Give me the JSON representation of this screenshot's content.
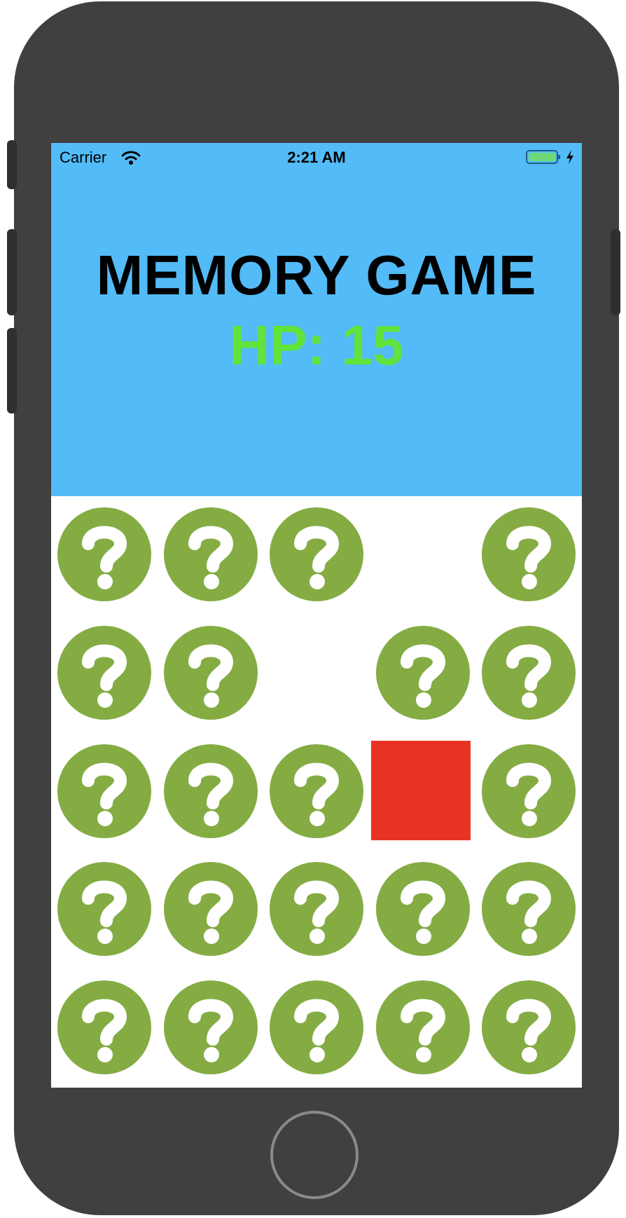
{
  "status_bar": {
    "carrier": "Carrier",
    "time": "2:21 AM",
    "icons": [
      "wifi-icon",
      "battery-icon",
      "charging-icon"
    ]
  },
  "header": {
    "title": "MEMORY GAME",
    "hp_label": "HP:",
    "hp_value": "15",
    "background_color": "#53bbf7",
    "hp_color": "#62e33c"
  },
  "board": {
    "rows": 5,
    "columns": 5,
    "tile_icon": "question-mark-icon",
    "tile_color": "#84ac43",
    "revealed_color": "#e73323",
    "tiles": [
      [
        "hidden",
        "hidden",
        "hidden",
        "empty",
        "hidden"
      ],
      [
        "hidden",
        "hidden",
        "empty",
        "hidden",
        "hidden"
      ],
      [
        "hidden",
        "hidden",
        "hidden",
        "revealed",
        "hidden"
      ],
      [
        "hidden",
        "hidden",
        "hidden",
        "hidden",
        "hidden"
      ],
      [
        "hidden",
        "hidden",
        "hidden",
        "hidden",
        "hidden"
      ]
    ]
  },
  "device": {
    "body_color": "#404040"
  }
}
